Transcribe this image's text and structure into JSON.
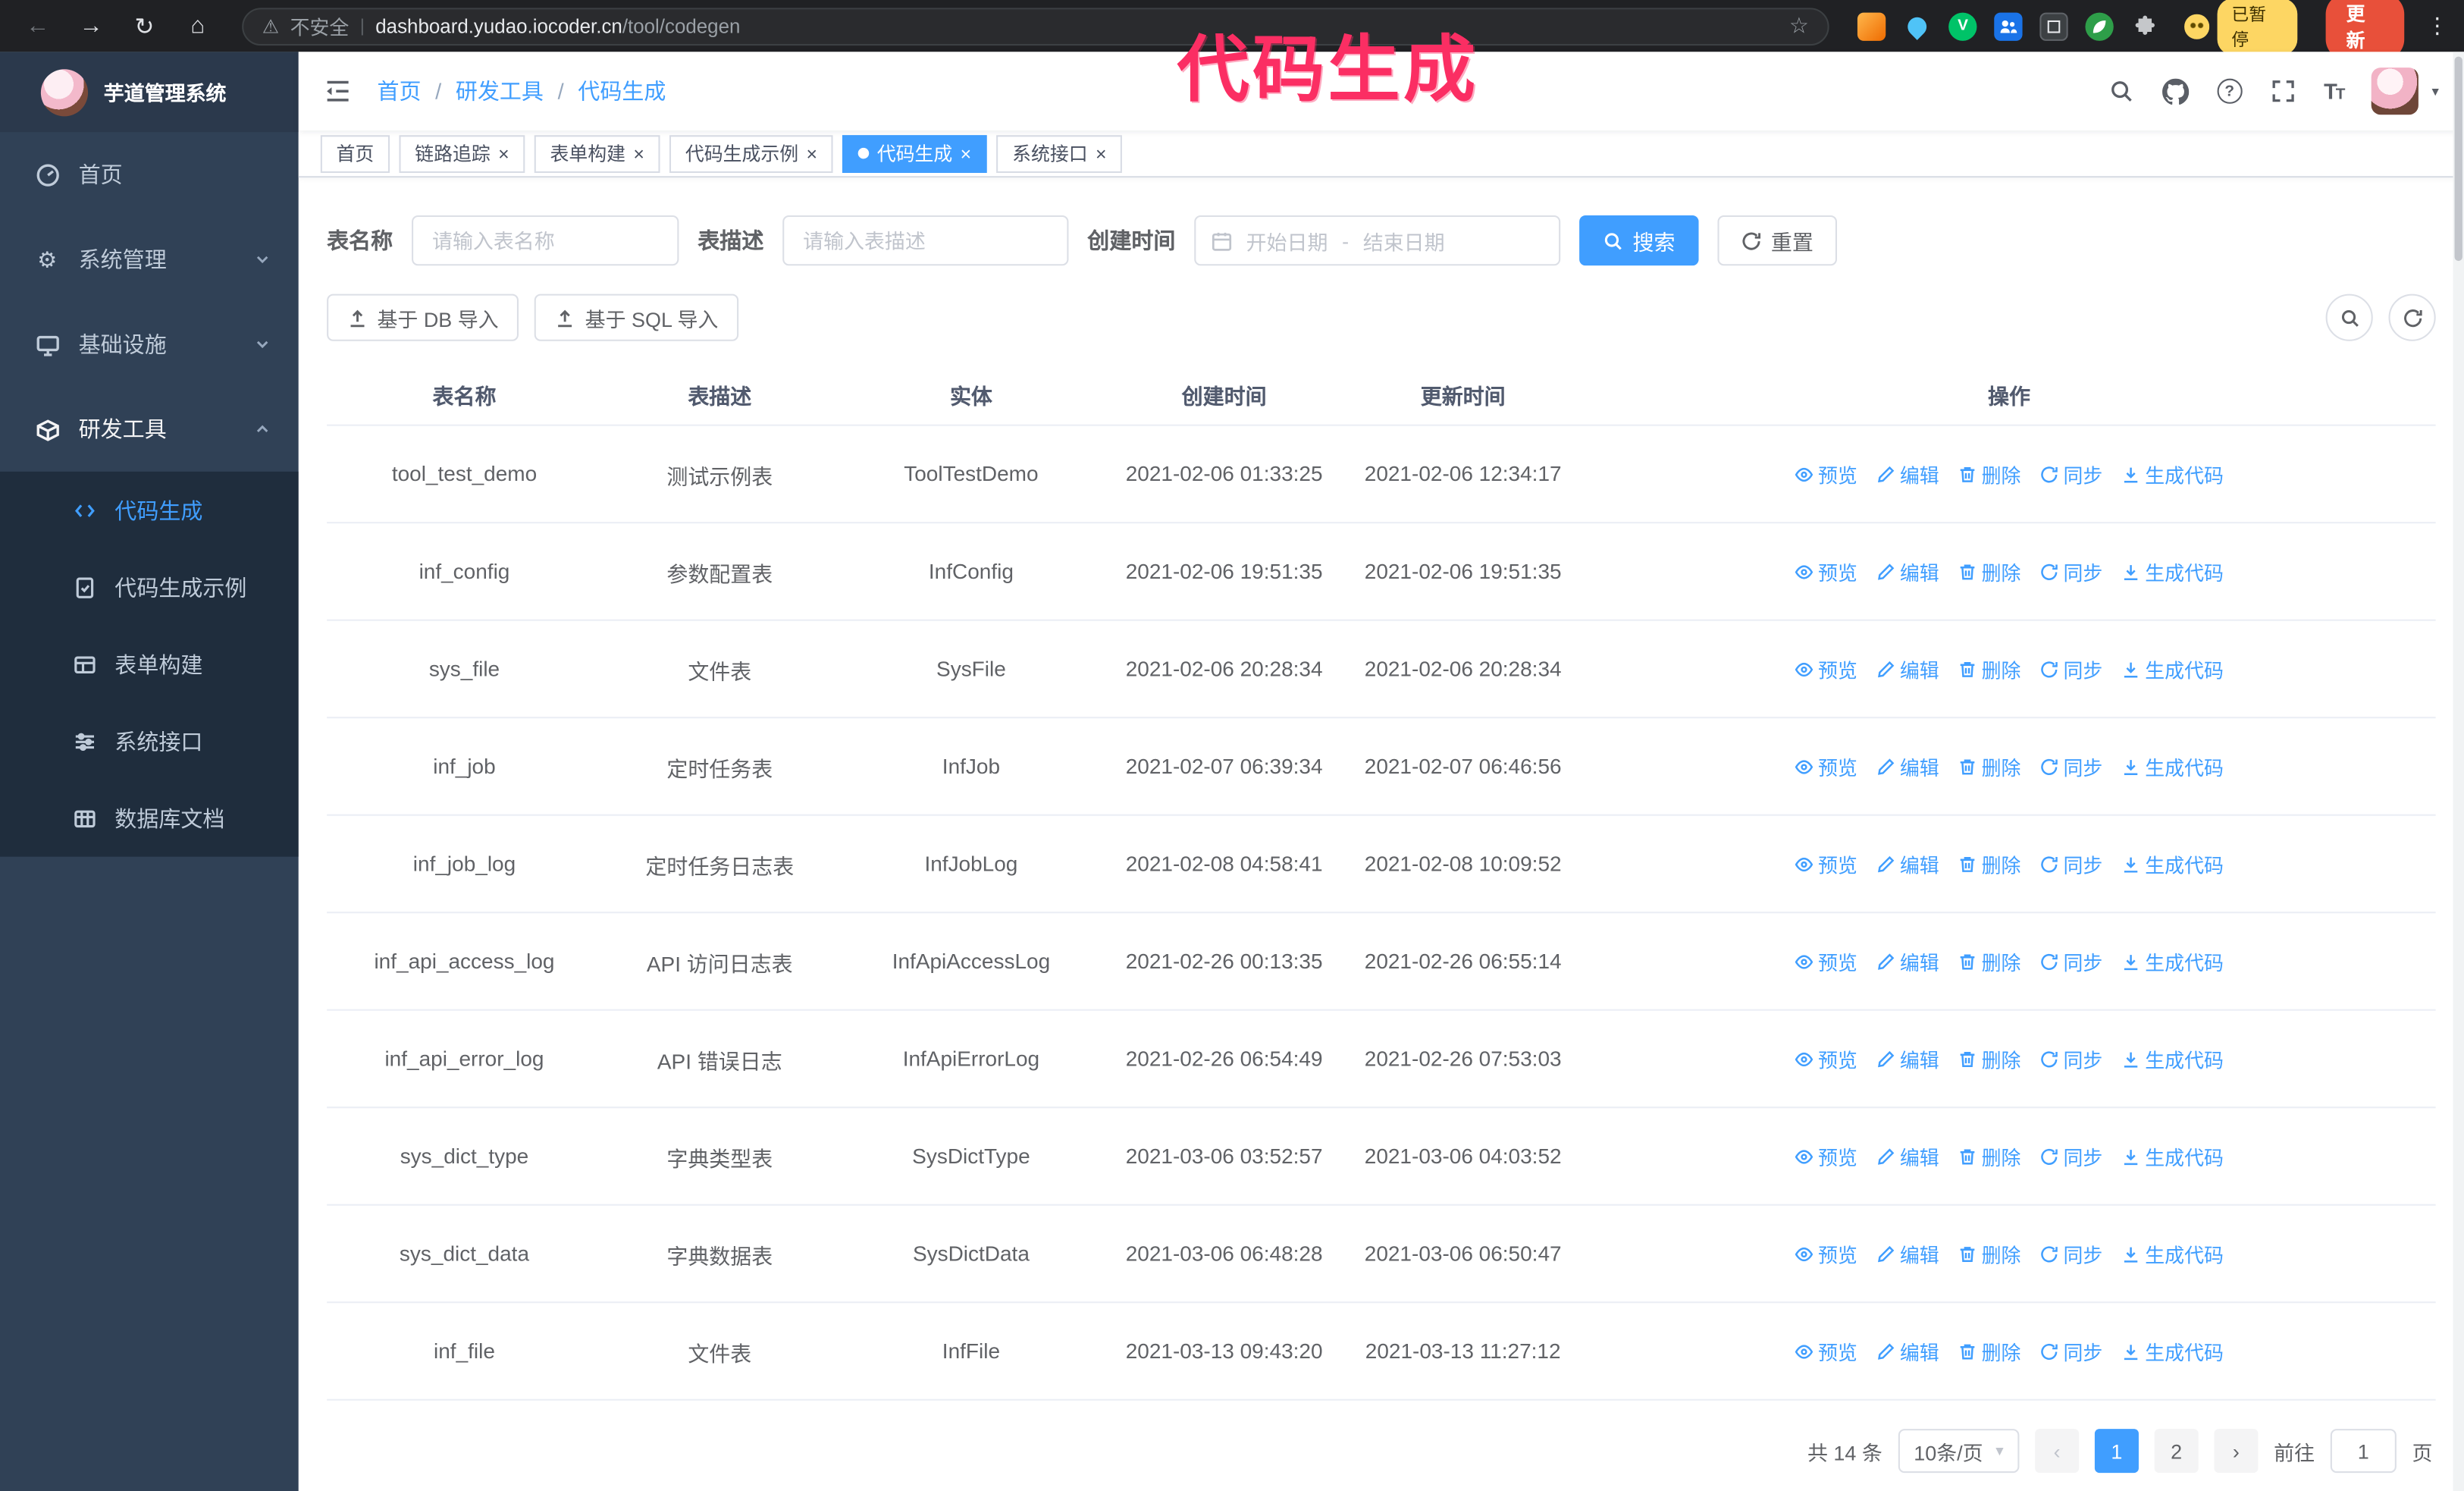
{
  "colors": {
    "accent": "#409eff",
    "sidebar_bg": "#304156",
    "submenu_bg": "#1f2d3d",
    "chrome_bg": "#202124",
    "annotation": "#fb2e63",
    "update_badge": "#e8503a",
    "paused_badge": "#fdd663"
  },
  "annotation": {
    "text": "代码生成"
  },
  "browser": {
    "security_label": "不安全",
    "url_domain": "dashboard.yudao.iocoder.cn",
    "url_path": "/tool/codegen",
    "paused_badge": "已暂停",
    "update_button": "更新"
  },
  "sidebar": {
    "logo_title": "芋道管理系统",
    "items": [
      "首页",
      "系统管理",
      "基础设施",
      "研发工具"
    ],
    "subitems": [
      "代码生成",
      "代码生成示例",
      "表单构建",
      "系统接口",
      "数据库文档"
    ]
  },
  "header": {
    "separator": "/",
    "breadcrumb": [
      "首页",
      "研发工具",
      "代码生成"
    ]
  },
  "tabs": [
    "首页",
    "链路追踪",
    "表单构建",
    "代码生成示例",
    "代码生成",
    "系统接口"
  ],
  "filters": {
    "table_name_label": "表名称",
    "table_name_placeholder": "请输入表名称",
    "table_desc_label": "表描述",
    "table_desc_placeholder": "请输入表描述",
    "create_time_label": "创建时间",
    "start_date_placeholder": "开始日期",
    "range_separator": "-",
    "end_date_placeholder": "结束日期",
    "search_button": "搜索",
    "reset_button": "重置"
  },
  "toolbar": {
    "import_db_button": "基于 DB 导入",
    "import_sql_button": "基于 SQL 导入"
  },
  "table": {
    "columns": [
      "表名称",
      "表描述",
      "实体",
      "创建时间",
      "更新时间",
      "操作"
    ],
    "actions": [
      "预览",
      "编辑",
      "删除",
      "同步",
      "生成代码"
    ],
    "rows": [
      {
        "name": "tool_test_demo",
        "desc": "测试示例表",
        "entity": "ToolTestDemo",
        "created": "2021-02-06 01:33:25",
        "updated": "2021-02-06 12:34:17"
      },
      {
        "name": "inf_config",
        "desc": "参数配置表",
        "entity": "InfConfig",
        "created": "2021-02-06 19:51:35",
        "updated": "2021-02-06 19:51:35"
      },
      {
        "name": "sys_file",
        "desc": "文件表",
        "entity": "SysFile",
        "created": "2021-02-06 20:28:34",
        "updated": "2021-02-06 20:28:34"
      },
      {
        "name": "inf_job",
        "desc": "定时任务表",
        "entity": "InfJob",
        "created": "2021-02-07 06:39:34",
        "updated": "2021-02-07 06:46:56"
      },
      {
        "name": "inf_job_log",
        "desc": "定时任务日志表",
        "entity": "InfJobLog",
        "created": "2021-02-08 04:58:41",
        "updated": "2021-02-08 10:09:52"
      },
      {
        "name": "inf_api_access_log",
        "desc": "API 访问日志表",
        "entity": "InfApiAccessLog",
        "created": "2021-02-26 00:13:35",
        "updated": "2021-02-26 06:55:14"
      },
      {
        "name": "inf_api_error_log",
        "desc": "API 错误日志",
        "entity": "InfApiErrorLog",
        "created": "2021-02-26 06:54:49",
        "updated": "2021-02-26 07:53:03"
      },
      {
        "name": "sys_dict_type",
        "desc": "字典类型表",
        "entity": "SysDictType",
        "created": "2021-03-06 03:52:57",
        "updated": "2021-03-06 04:03:52"
      },
      {
        "name": "sys_dict_data",
        "desc": "字典数据表",
        "entity": "SysDictData",
        "created": "2021-03-06 06:48:28",
        "updated": "2021-03-06 06:50:47"
      },
      {
        "name": "inf_file",
        "desc": "文件表",
        "entity": "InfFile",
        "created": "2021-03-13 09:43:20",
        "updated": "2021-03-13 11:27:12"
      }
    ]
  },
  "pagination": {
    "total_text": "共 14 条",
    "page_size": "10条/页",
    "prev": "‹",
    "pages": [
      "1",
      "2"
    ],
    "next": "›",
    "goto_prefix": "前往",
    "goto_value": "1",
    "goto_suffix": "页"
  }
}
